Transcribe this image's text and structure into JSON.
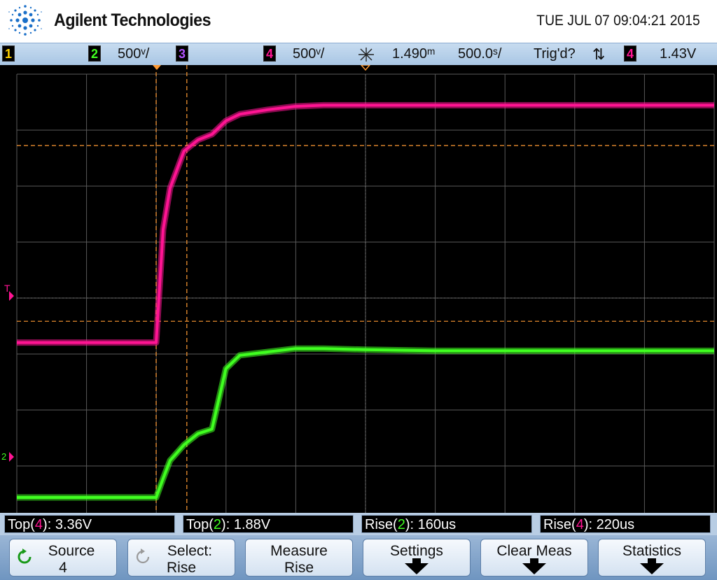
{
  "header": {
    "brand": "Agilent Technologies",
    "datetime": "TUE JUL 07 09:04:21 2015"
  },
  "status_bar": {
    "ch1_label": "1",
    "ch2_label": "2",
    "ch2_scale": "500ᵛ/",
    "ch3_label": "3",
    "ch4_label": "4",
    "ch4_scale": "500ᵛ/",
    "time_delay": "1.490ᵐ",
    "time_scale": "500.0ˢ/",
    "trigger_status": "Trig'd?",
    "trigger_slope_symbol": "⇅",
    "trigger_source": "4",
    "trigger_level": "1.43V"
  },
  "screen": {
    "trigger_marker": "T",
    "ground_marker": "2",
    "colors": {
      "ch2": "#40ff20",
      "ch4": "#ff1493",
      "cursor": "#ff9a33",
      "grid": "#5a5a5a"
    }
  },
  "chart_data": {
    "type": "line",
    "x": [
      -2.0,
      -1.0,
      -0.5,
      0.0,
      0.05,
      0.1,
      0.2,
      0.3,
      0.4,
      0.5,
      0.6,
      0.8,
      1.0,
      1.2,
      1.5,
      2.0,
      3.0,
      4.0,
      5.0,
      6.0,
      7.0,
      8.0
    ],
    "series": [
      {
        "values": [
          0.55,
          0.55,
          0.55,
          0.55,
          0.72,
          0.88,
          1.02,
          1.12,
          1.16,
          1.7,
          1.82,
          1.85,
          1.88,
          1.88,
          1.87,
          1.86,
          1.86,
          1.86,
          1.86,
          1.86,
          1.86,
          1.86
        ]
      },
      {
        "values": [
          1.24,
          1.24,
          1.24,
          1.24,
          2.25,
          2.62,
          2.95,
          3.05,
          3.1,
          3.22,
          3.28,
          3.32,
          3.35,
          3.36,
          3.36,
          3.36,
          3.36,
          3.36,
          3.36,
          3.36,
          3.36,
          3.36
        ]
      }
    ],
    "cursors_time": [
      0.0,
      0.22
    ],
    "cursors_voltage": [
      3.0,
      1.43
    ]
  },
  "measurements": [
    {
      "name": "Top",
      "channel": "4",
      "value": "3.36V"
    },
    {
      "name": "Top",
      "channel": "2",
      "value": "1.88V"
    },
    {
      "name": "Rise",
      "channel": "2",
      "value": "160us"
    },
    {
      "name": "Rise",
      "channel": "4",
      "value": "220us"
    }
  ],
  "softkeys": [
    {
      "line1": "Source",
      "line2": "4"
    },
    {
      "line1": "Select:",
      "line2": "Rise"
    },
    {
      "line1": "Measure",
      "line2": "Rise"
    },
    {
      "line1": "Settings",
      "line2": ""
    },
    {
      "line1": "Clear Meas",
      "line2": ""
    },
    {
      "line1": "Statistics",
      "line2": ""
    }
  ]
}
